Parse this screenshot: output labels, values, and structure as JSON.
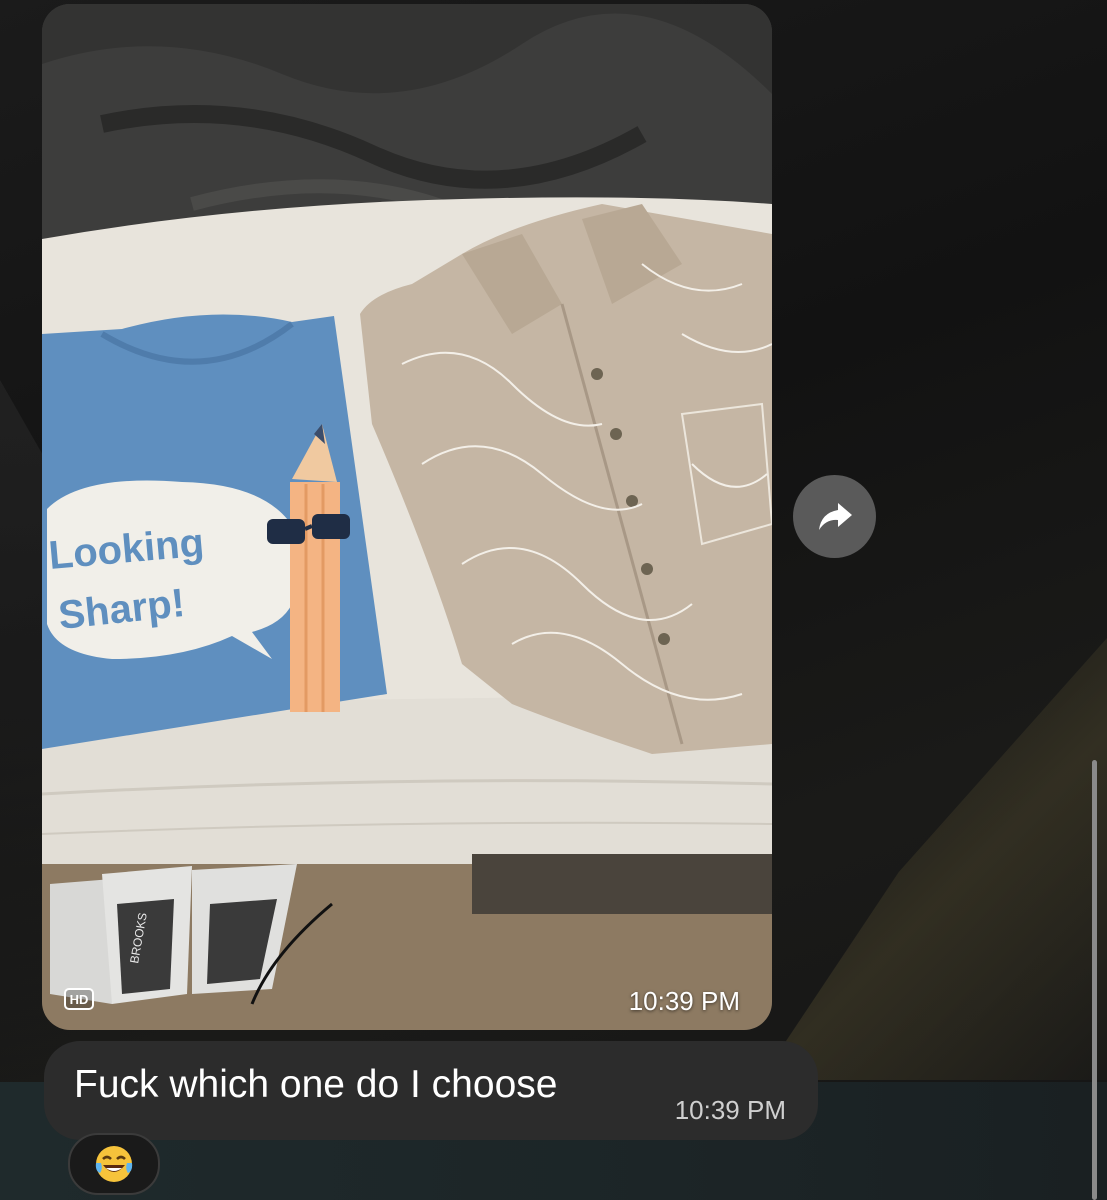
{
  "image_message": {
    "hd_label": "HD",
    "time": "10:39 PM",
    "shirt_print_line1": "Looking",
    "shirt_print_line2": "Sharp!",
    "shoe_brand": "BROOKS"
  },
  "forward_button": {
    "icon": "forward-arrow-icon"
  },
  "text_message": {
    "text": "Fuck which one do I choose",
    "time": "10:39 PM"
  },
  "reaction": {
    "emoji": "😂",
    "icon": "laughing-tears-emoji-icon"
  },
  "colors": {
    "bubble": "#2c2c2c",
    "forward_button": "#5a5a5a",
    "tshirt_blue": "#5f8fbf",
    "shirt_tan": "#c5b6a4"
  }
}
